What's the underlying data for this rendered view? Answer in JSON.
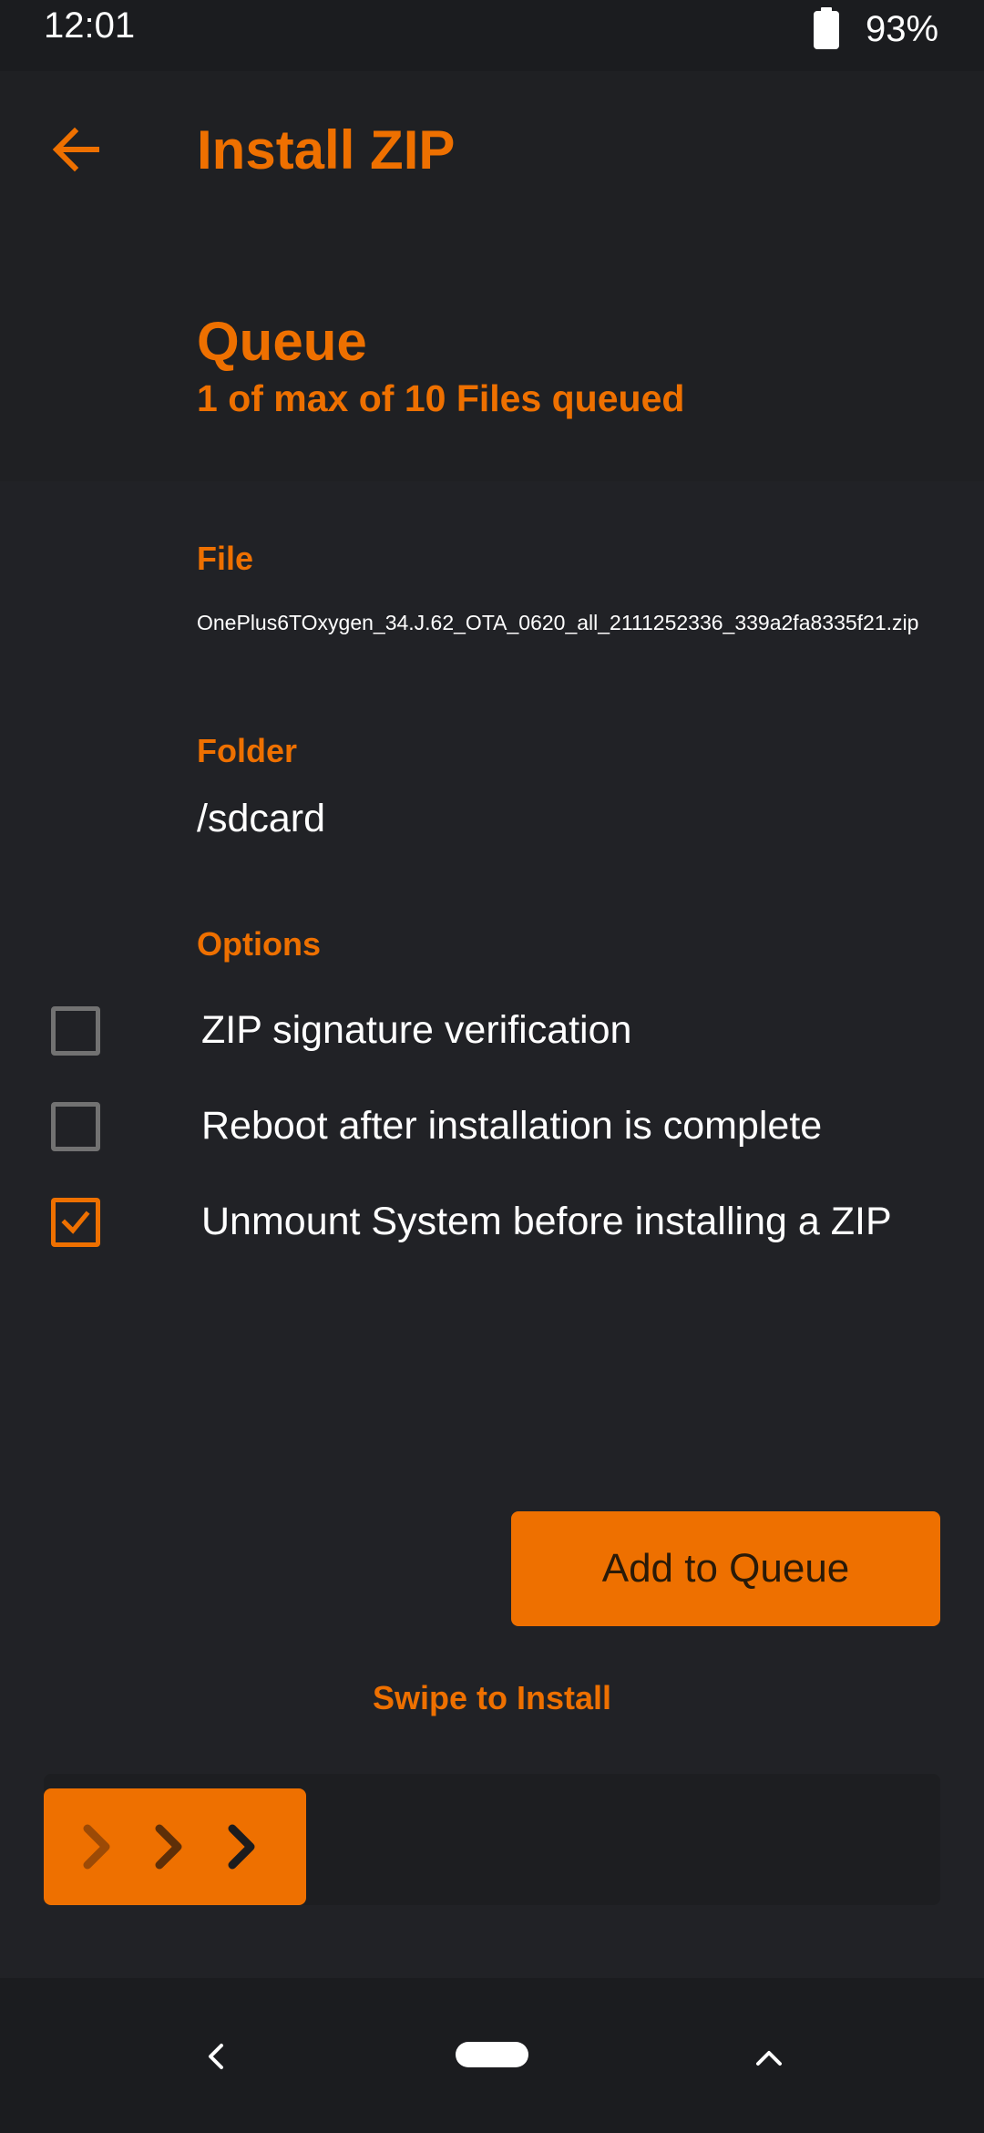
{
  "status_bar": {
    "time": "12:01",
    "battery_icon": "battery-icon",
    "battery_level": "93%"
  },
  "header": {
    "back_icon": "back-arrow-icon",
    "title": "Install ZIP"
  },
  "queue": {
    "title": "Queue",
    "subtitle": "1 of max of 10 Files queued"
  },
  "file": {
    "label": "File",
    "value": "OnePlus6TOxygen_34.J.62_OTA_0620_all_2111252336_339a2fa8335f21.zip"
  },
  "folder": {
    "label": "Folder",
    "value": "/sdcard"
  },
  "options": {
    "label": "Options",
    "items": [
      {
        "label": "ZIP signature verification",
        "checked": false
      },
      {
        "label": "Reboot after installation is complete",
        "checked": false
      },
      {
        "label": "Unmount System before installing a ZIP",
        "checked": true
      }
    ]
  },
  "actions": {
    "add_to_queue_label": "Add to Queue",
    "swipe_label": "Swipe to Install",
    "swipe_icon": "chevrons-right-icon"
  },
  "nav_bar": {
    "back_icon": "nav-back-icon",
    "home_icon": "home-pill-icon",
    "recents_icon": "chevron-up-icon"
  },
  "colors": {
    "accent": "#ee7000",
    "background": "#212226",
    "text": "#ffffff"
  }
}
